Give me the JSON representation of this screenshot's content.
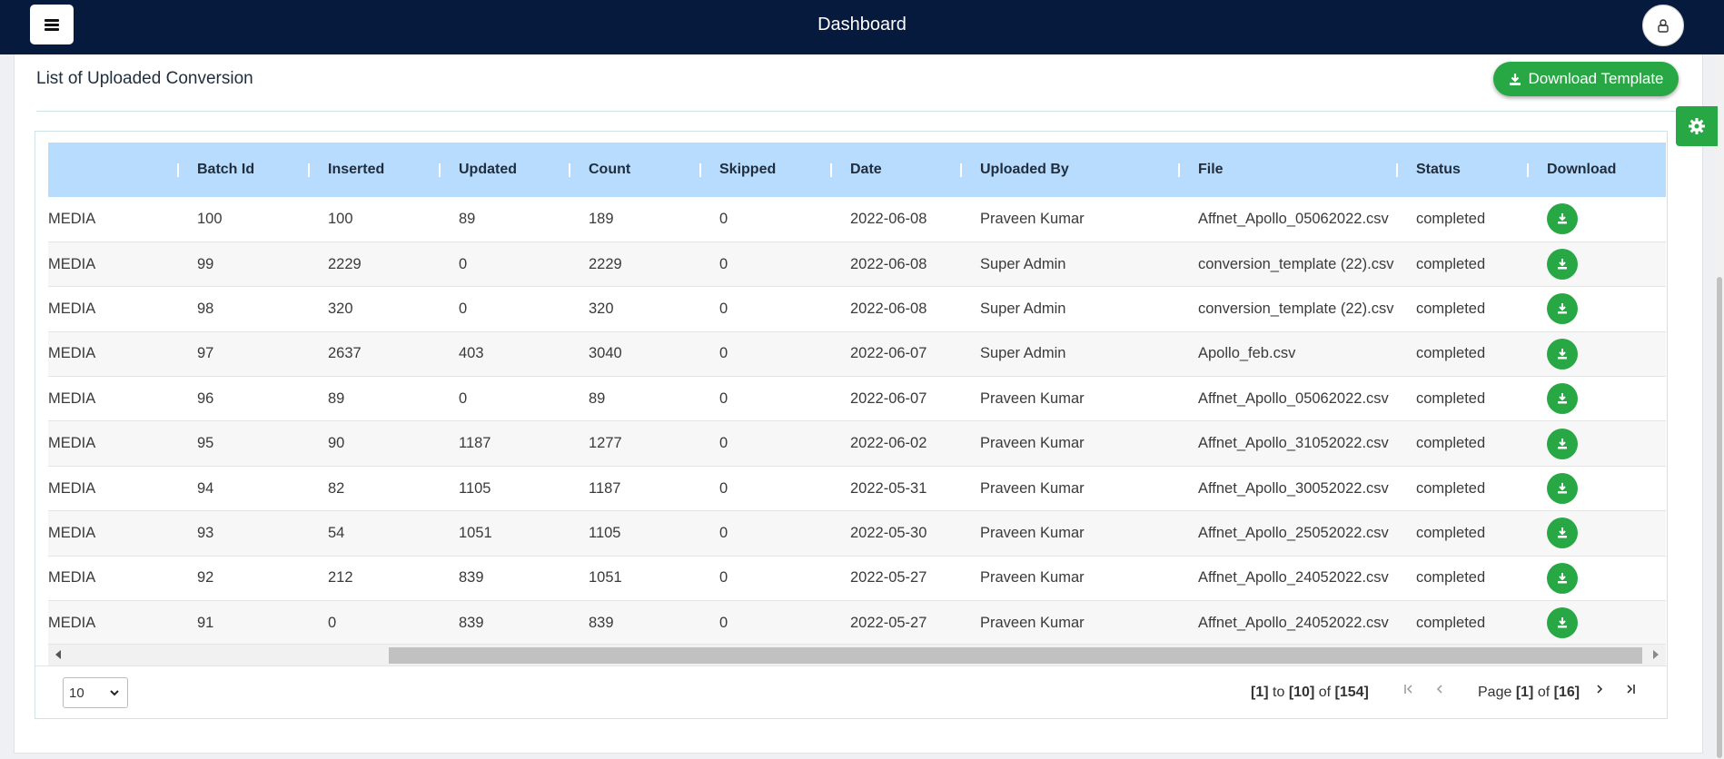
{
  "header": {
    "title": "Dashboard"
  },
  "card": {
    "title": "List of Uploaded Conversion",
    "download_template_label": "Download Template"
  },
  "table": {
    "columns": [
      "",
      "Batch Id",
      "Inserted",
      "Updated",
      "Count",
      "Skipped",
      "Date",
      "Uploaded By",
      "File",
      "Status",
      "Download"
    ],
    "rows": [
      [
        "MEDIA",
        "100",
        "100",
        "89",
        "189",
        "0",
        "2022-06-08",
        "Praveen Kumar",
        "Affnet_Apollo_05062022.csv",
        "completed"
      ],
      [
        "MEDIA",
        "99",
        "2229",
        "0",
        "2229",
        "0",
        "2022-06-08",
        "Super Admin",
        "conversion_template (22).csv",
        "completed"
      ],
      [
        "MEDIA",
        "98",
        "320",
        "0",
        "320",
        "0",
        "2022-06-08",
        "Super Admin",
        "conversion_template (22).csv",
        "completed"
      ],
      [
        "MEDIA",
        "97",
        "2637",
        "403",
        "3040",
        "0",
        "2022-06-07",
        "Super Admin",
        "Apollo_feb.csv",
        "completed"
      ],
      [
        "MEDIA",
        "96",
        "89",
        "0",
        "89",
        "0",
        "2022-06-07",
        "Praveen Kumar",
        "Affnet_Apollo_05062022.csv",
        "completed"
      ],
      [
        "MEDIA",
        "95",
        "90",
        "1187",
        "1277",
        "0",
        "2022-06-02",
        "Praveen Kumar",
        "Affnet_Apollo_31052022.csv",
        "completed"
      ],
      [
        "MEDIA",
        "94",
        "82",
        "1105",
        "1187",
        "0",
        "2022-05-31",
        "Praveen Kumar",
        "Affnet_Apollo_30052022.csv",
        "completed"
      ],
      [
        "MEDIA",
        "93",
        "54",
        "1051",
        "1105",
        "0",
        "2022-05-30",
        "Praveen Kumar",
        "Affnet_Apollo_25052022.csv",
        "completed"
      ],
      [
        "MEDIA",
        "92",
        "212",
        "839",
        "1051",
        "0",
        "2022-05-27",
        "Praveen Kumar",
        "Affnet_Apollo_24052022.csv",
        "completed"
      ],
      [
        "MEDIA",
        "91",
        "0",
        "839",
        "839",
        "0",
        "2022-05-27",
        "Praveen Kumar",
        "Affnet_Apollo_24052022.csv",
        "completed"
      ]
    ]
  },
  "pagination": {
    "page_size": "10",
    "from": "[1]",
    "to_word": "to",
    "to": "[10]",
    "of_word": "of",
    "total": "[154]",
    "page_word": "Page",
    "current_page": "[1]",
    "of_word2": "of",
    "total_pages": "[16]"
  },
  "icons": {
    "menu": "menu-icon",
    "user": "user-icon",
    "download": "download-icon",
    "settings": "gear-icon"
  },
  "colors": {
    "navbar": "#061a3d",
    "accent": "#28a745",
    "table_header": "#b8dcfd"
  }
}
